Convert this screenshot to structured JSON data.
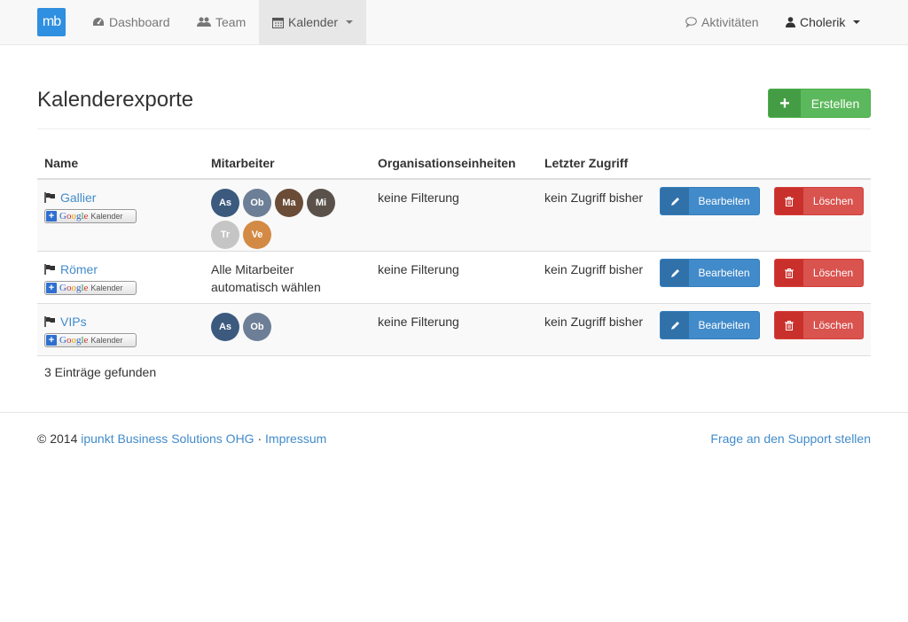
{
  "brand": {
    "logo_text": "mb",
    "color": "#2f8fe0"
  },
  "nav": {
    "items": [
      {
        "label": "Dashboard",
        "icon": "dashboard-icon"
      },
      {
        "label": "Team",
        "icon": "users-icon"
      },
      {
        "label": "Kalender",
        "icon": "calendar-icon",
        "active": true
      }
    ],
    "activity": {
      "label": "Aktivitäten",
      "icon": "comment-icon"
    },
    "user": {
      "label": "Cholerik",
      "icon": "user-icon"
    }
  },
  "page": {
    "title": "Kalenderexporte",
    "create_label": "Erstellen",
    "create_icon": "+"
  },
  "table": {
    "headers": [
      "Name",
      "Mitarbeiter",
      "Organisationseinheiten",
      "Letzter Zugriff"
    ],
    "google_badge": {
      "plus": "+",
      "brand": "Google",
      "label": "Kalender"
    },
    "rows": [
      {
        "name": "Gallier",
        "avatars": [
          {
            "initials": "As",
            "color": "#3b5a7e"
          },
          {
            "initials": "Ob",
            "color": "#6d7f96"
          },
          {
            "initials": "Ma",
            "color": "#6b4c37"
          },
          {
            "initials": "Mi",
            "color": "#5a524a"
          },
          {
            "initials": "Tr",
            "color": "#c5c5c5"
          },
          {
            "initials": "Ve",
            "color": "#d28a45"
          }
        ],
        "members_text": "",
        "org_units": "keine Filterung",
        "last_access": "kein Zugriff bisher",
        "edit_label": "Bearbeiten",
        "delete_label": "Löschen"
      },
      {
        "name": "Römer",
        "avatars": [],
        "members_text_line1": "Alle Mitarbeiter",
        "members_text_line2": "automatisch wählen",
        "org_units": "keine Filterung",
        "last_access": "kein Zugriff bisher",
        "edit_label": "Bearbeiten",
        "delete_label": "Löschen"
      },
      {
        "name": "VIPs",
        "avatars": [
          {
            "initials": "As",
            "color": "#3b5a7e"
          },
          {
            "initials": "Ob",
            "color": "#6d7f96"
          }
        ],
        "members_text": "",
        "org_units": "keine Filterung",
        "last_access": "kein Zugriff bisher",
        "edit_label": "Bearbeiten",
        "delete_label": "Löschen"
      }
    ],
    "count_text": "3 Einträge gefunden"
  },
  "footer": {
    "copyright": "© 2014",
    "company_link": "ipunkt Business Solutions OHG",
    "separator": "·",
    "impressum_link": "Impressum",
    "support_link": "Frage an den Support stellen"
  },
  "colors": {
    "primary": "#428bca",
    "success": "#5cb85c",
    "danger": "#d9534f"
  }
}
